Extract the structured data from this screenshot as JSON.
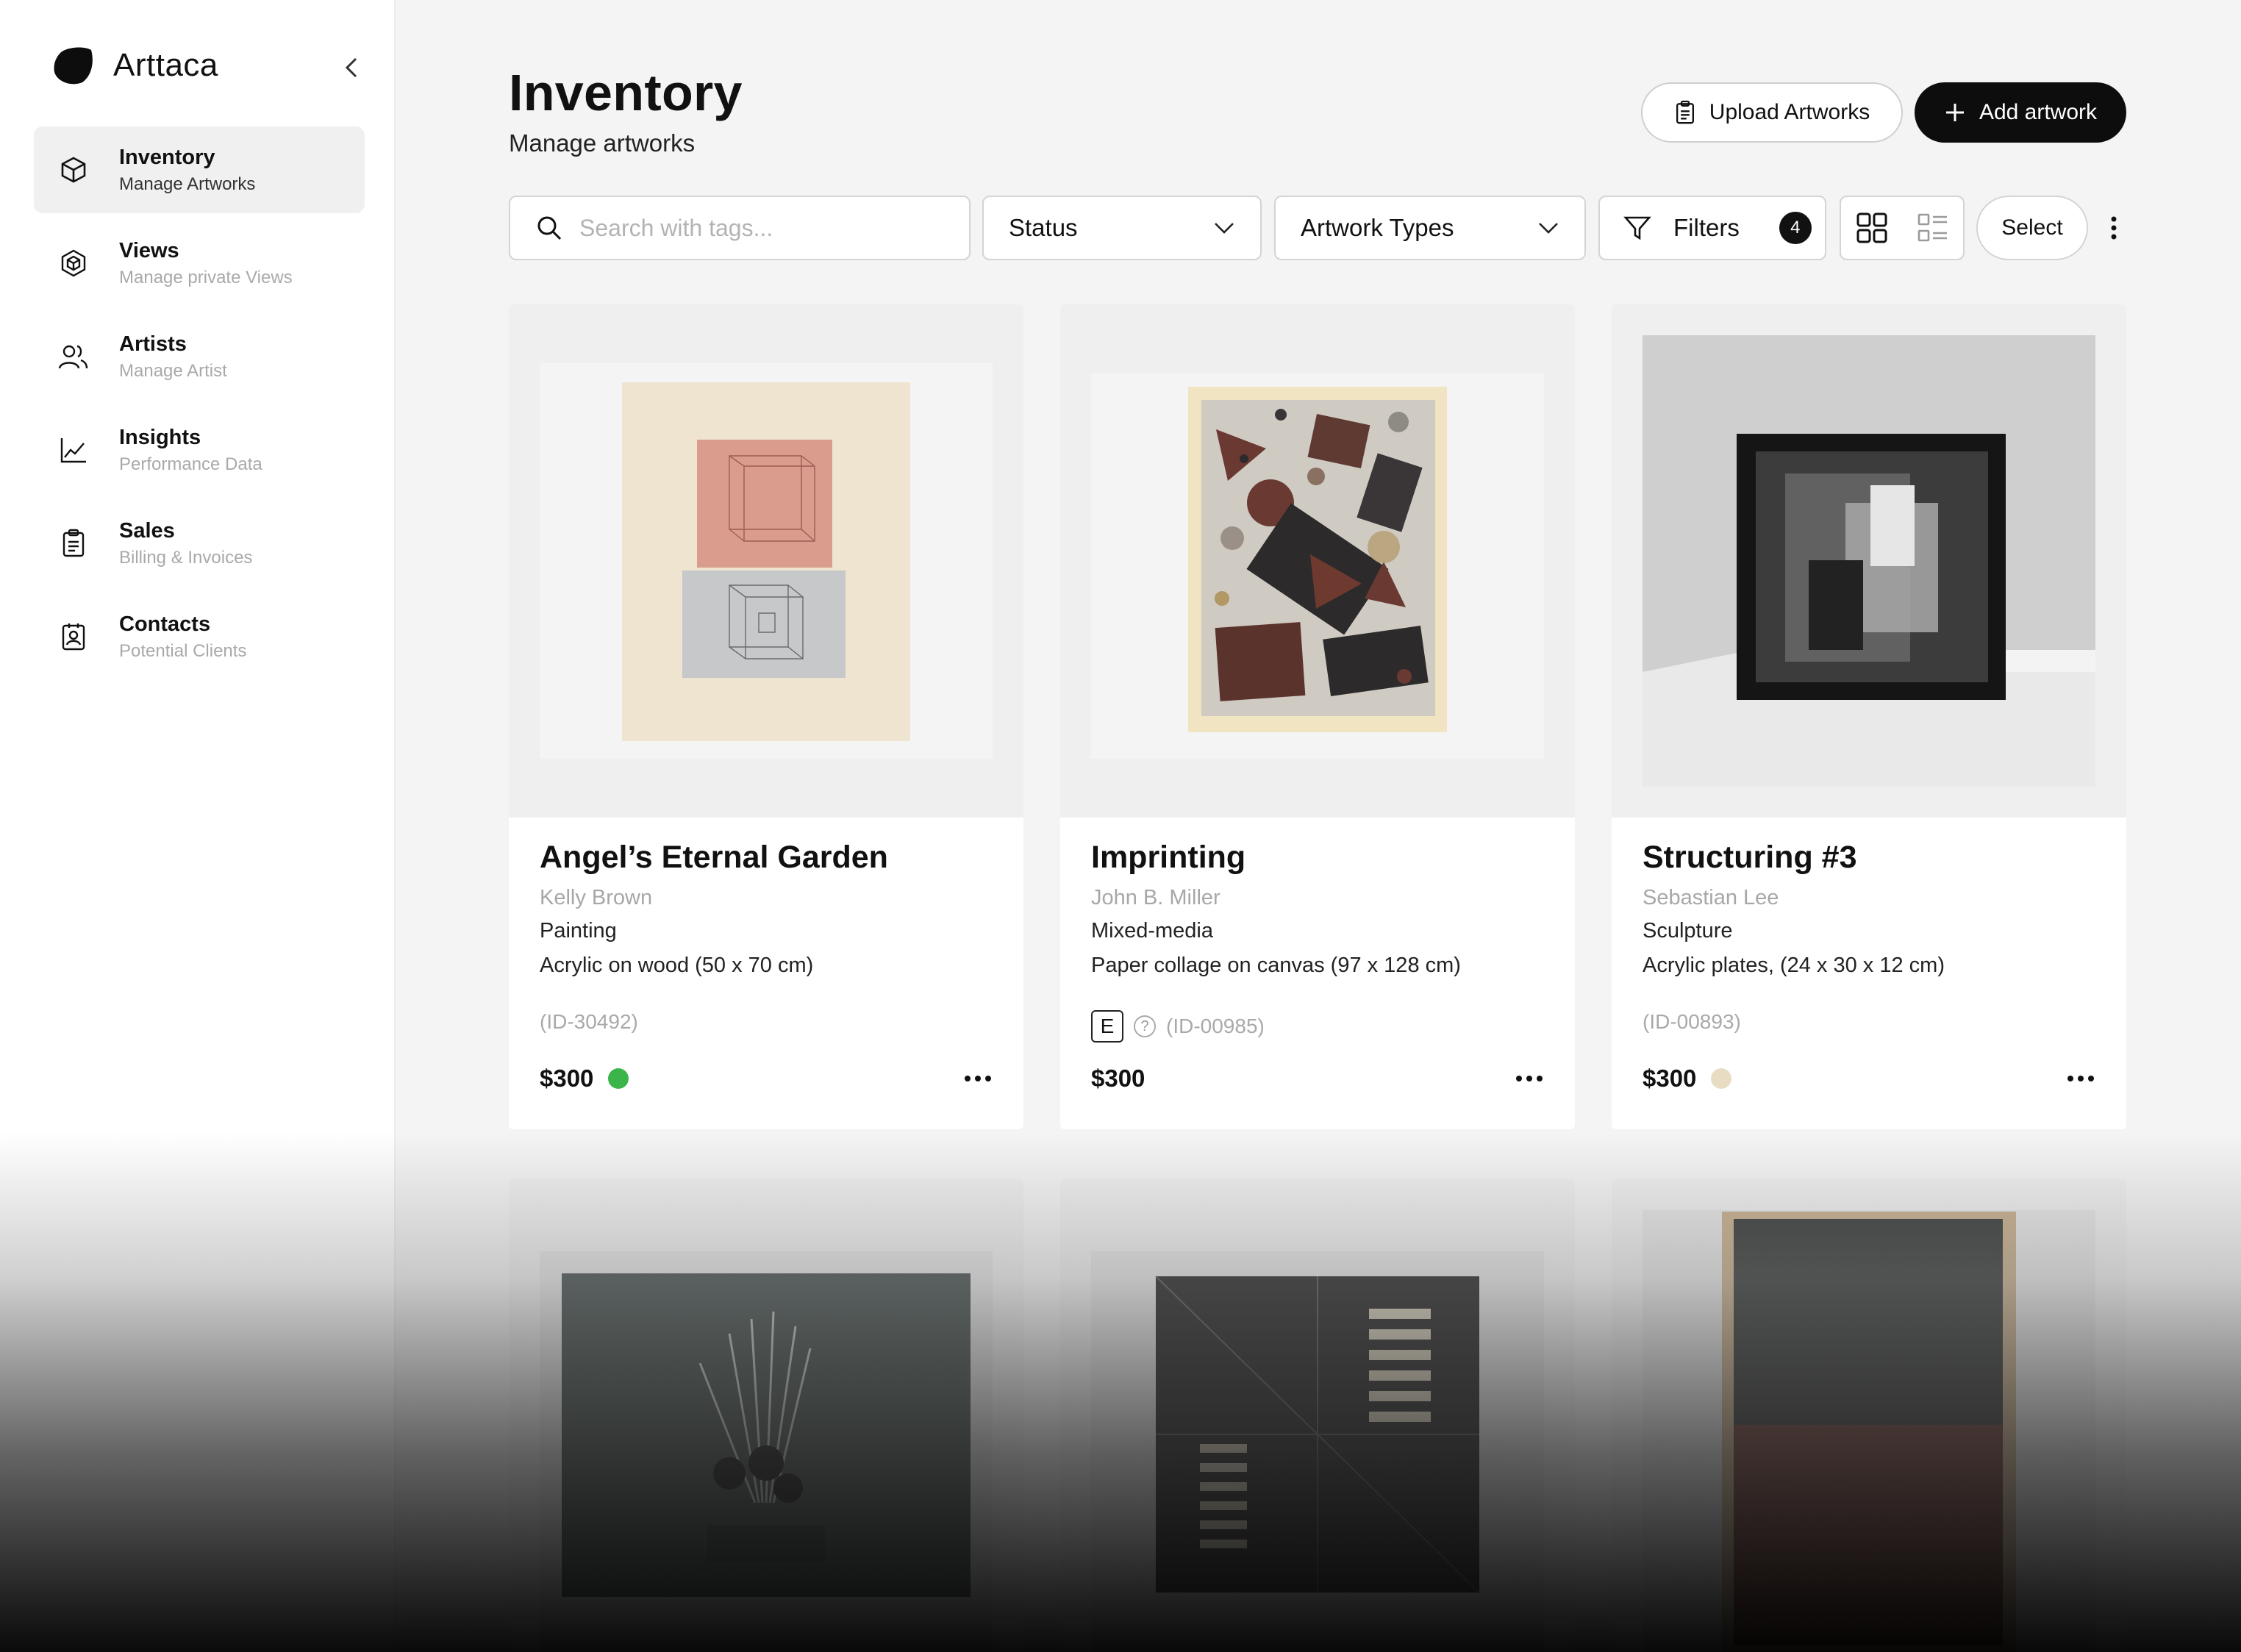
{
  "app": {
    "name": "Arttaca"
  },
  "sidebar": {
    "items": [
      {
        "label": "Inventory",
        "sub": "Manage Artworks",
        "icon": "cube-icon",
        "active": true
      },
      {
        "label": "Views",
        "sub": "Manage private Views",
        "icon": "views-icon",
        "active": false
      },
      {
        "label": "Artists",
        "sub": "Manage Artist",
        "icon": "users-icon",
        "active": false
      },
      {
        "label": "Insights",
        "sub": "Performance Data",
        "icon": "chart-line-icon",
        "active": false
      },
      {
        "label": "Sales",
        "sub": "Billing & Invoices",
        "icon": "clipboard-icon",
        "active": false
      },
      {
        "label": "Contacts",
        "sub": "Potential Clients",
        "icon": "contact-icon",
        "active": false
      }
    ]
  },
  "header": {
    "title": "Inventory",
    "subtitle": "Manage artworks",
    "upload_label": "Upload Artworks",
    "add_label": "Add artwork"
  },
  "toolbar": {
    "search_placeholder": "Search with tags...",
    "status_label": "Status",
    "types_label": "Artwork Types",
    "filters_label": "Filters",
    "filters_count": "4",
    "select_label": "Select"
  },
  "artworks": [
    {
      "title": "Angel’s Eternal Garden",
      "artist": "Kelly Brown",
      "type": "Painting",
      "medium": "Acrylic on wood  (50 x 70 cm)",
      "id": "(ID-30492)",
      "price": "$300",
      "status_color": "#3bb54a",
      "edition_badge": ""
    },
    {
      "title": "Imprinting",
      "artist": "John B. Miller",
      "type": "Mixed-media",
      "medium": "Paper collage on canvas  (97 x 128 cm)",
      "id": "(ID-00985)",
      "price": "$300",
      "status_color": "",
      "edition_badge": "E",
      "help": "?"
    },
    {
      "title": "Structuring #3",
      "artist": "Sebastian Lee",
      "type": "Sculpture",
      "medium": "Acrylic plates,  (24 x 30 x 12 cm)",
      "id": "(ID-00893)",
      "price": "$300",
      "status_color": "#e8dcc3",
      "edition_badge": ""
    }
  ],
  "colors": {
    "accent": "#0d0d0d",
    "available": "#3bb54a",
    "reserved": "#e8dcc3"
  }
}
